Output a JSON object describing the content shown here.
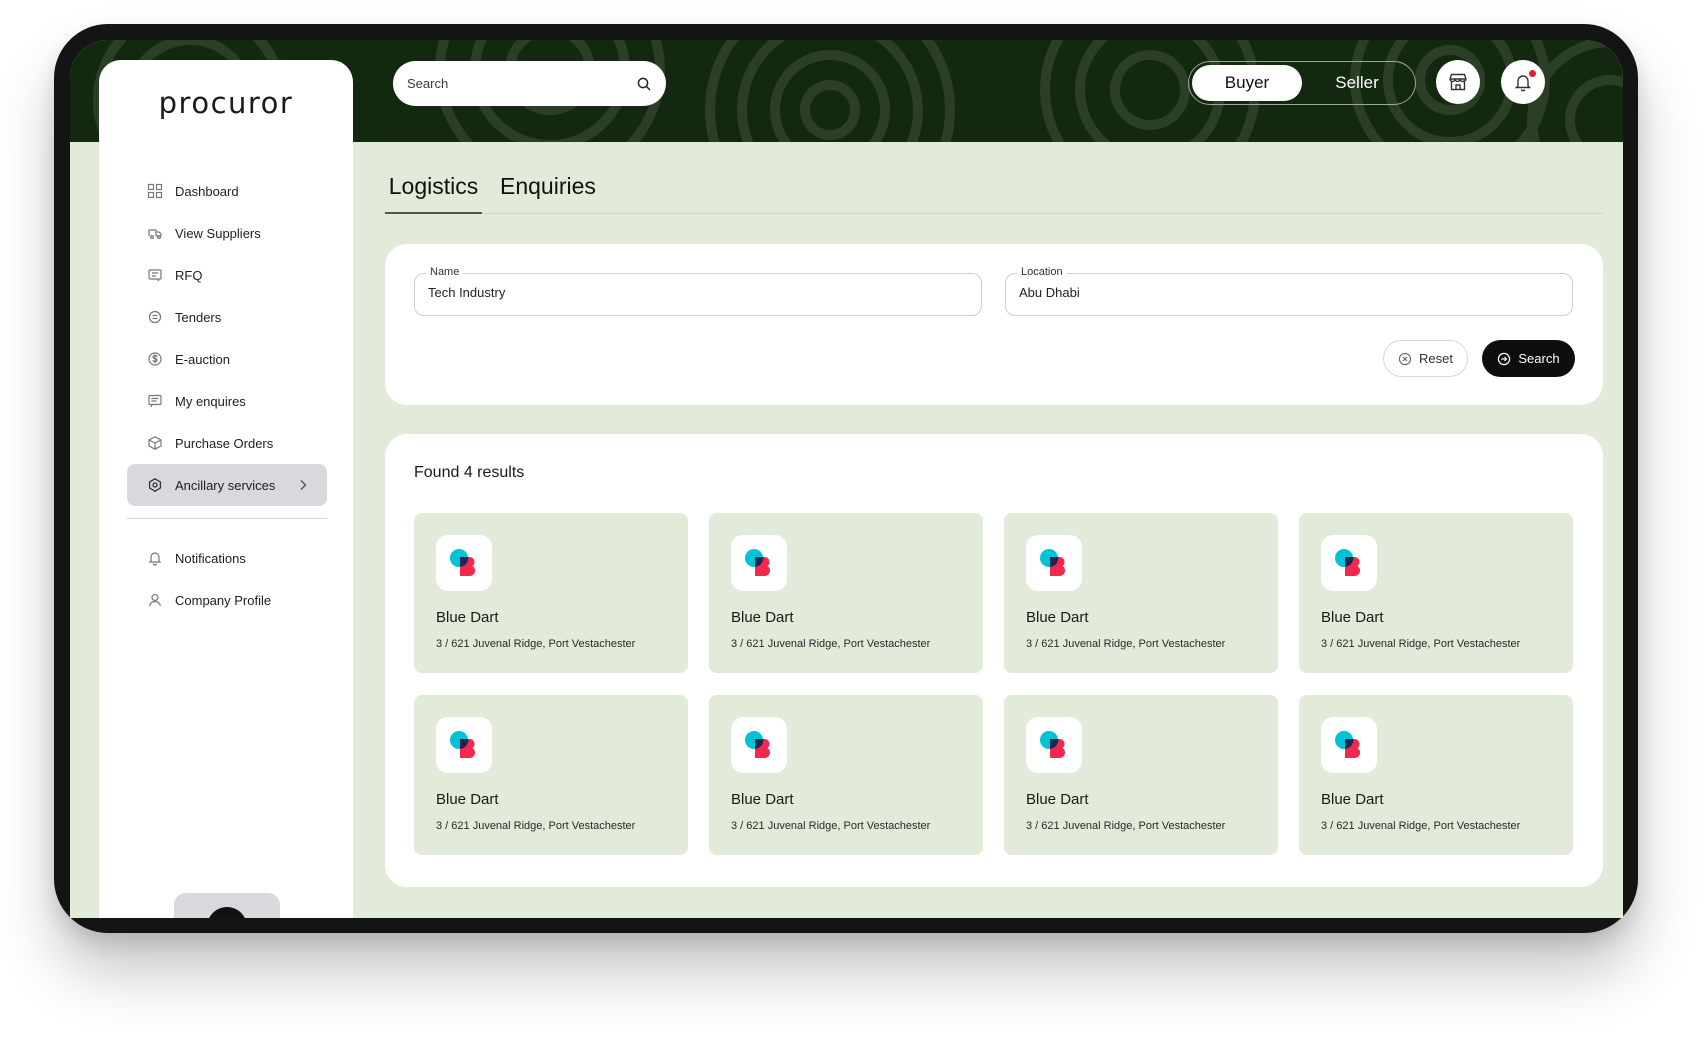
{
  "app": {
    "logo_text": "procuror"
  },
  "header": {
    "search_placeholder": "Search",
    "roles": [
      {
        "label": "Buyer",
        "active": true
      },
      {
        "label": "Seller",
        "active": false
      }
    ],
    "icons": [
      "store-icon",
      "bell-icon"
    ],
    "notification_indicator_color": "#e81c2c"
  },
  "sidebar": {
    "items": [
      {
        "label": "Dashboard",
        "icon": "grid-icon"
      },
      {
        "label": "View Suppliers",
        "icon": "truck-icon"
      },
      {
        "label": "RFQ",
        "icon": "document-icon"
      },
      {
        "label": "Tenders",
        "icon": "tender-icon"
      },
      {
        "label": "E-auction",
        "icon": "dollar-circle-icon"
      },
      {
        "label": "My enquires",
        "icon": "message-icon"
      },
      {
        "label": "Purchase Orders",
        "icon": "box-icon"
      },
      {
        "label": "Ancillary services",
        "icon": "settings-icon",
        "active": true
      }
    ],
    "secondary_items": [
      {
        "label": "Notifications",
        "icon": "bell-icon"
      },
      {
        "label": "Company Profile",
        "icon": "user-icon"
      }
    ]
  },
  "tabs": [
    {
      "label": "Logistics",
      "active": true
    },
    {
      "label": "Enquiries",
      "active": false
    }
  ],
  "filters": {
    "name": {
      "label": "Name",
      "value": "Tech Industry"
    },
    "location": {
      "label": "Location",
      "value": "Abu Dhabi"
    },
    "reset_label": "Reset",
    "search_label": "Search"
  },
  "results": {
    "title": "Found 4 results",
    "items": [
      {
        "name": "Blue Dart",
        "address": "3 / 621 Juvenal Ridge, Port Vestachester"
      },
      {
        "name": "Blue Dart",
        "address": "3 / 621 Juvenal Ridge, Port Vestachester"
      },
      {
        "name": "Blue Dart",
        "address": "3 / 621 Juvenal Ridge, Port Vestachester"
      },
      {
        "name": "Blue Dart",
        "address": "3 / 621 Juvenal Ridge, Port Vestachester"
      },
      {
        "name": "Blue Dart",
        "address": "3 / 621 Juvenal Ridge, Port Vestachester"
      },
      {
        "name": "Blue Dart",
        "address": "3 / 621 Juvenal Ridge, Port Vestachester"
      },
      {
        "name": "Blue Dart",
        "address": "3 / 621 Juvenal Ridge, Port Vestachester"
      },
      {
        "name": "Blue Dart",
        "address": "3 / 621 Juvenal Ridge, Port Vestachester"
      }
    ]
  },
  "colors": {
    "header_bg": "#13290f",
    "page_bg": "#e2ead9",
    "card_bg": "#e2ead9",
    "primary_button": "#0e0e0e",
    "logo_cyan": "#00c2d6",
    "logo_red": "#f2284f"
  }
}
